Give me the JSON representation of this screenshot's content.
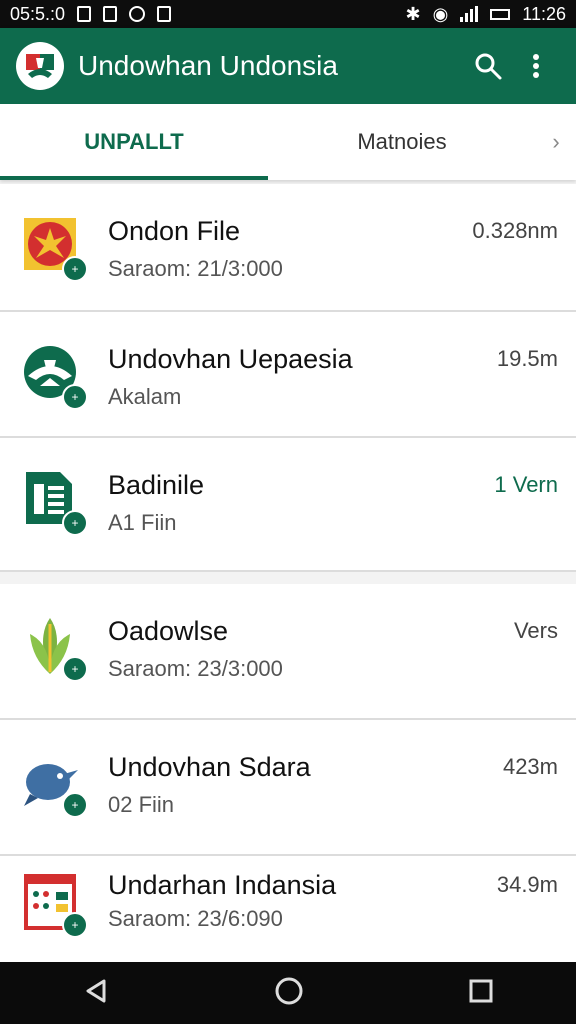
{
  "status": {
    "time_left": "05:5.:0",
    "time_right": "11:26"
  },
  "app_bar": {
    "title": "Undowhan Undonsia"
  },
  "tabs": [
    {
      "label": "UNPALLT",
      "active": true
    },
    {
      "label": "Matnoies",
      "active": false
    }
  ],
  "items": [
    {
      "name": "Ondon File",
      "sub": "Saraom: 21/3:000",
      "meta": "0.328nm",
      "icon": "emblem-icon"
    },
    {
      "name": "Undovhan Uepaesia",
      "sub": "Akalam",
      "meta": "19.5m",
      "icon": "garuda-icon"
    },
    {
      "name": "Badinile",
      "sub": "A1 Fiin",
      "meta": "1 Vern",
      "icon": "document-icon"
    },
    {
      "name": "Oadowlse",
      "sub": "Saraom: 23/3:000",
      "meta": "Vers",
      "icon": "plant-icon"
    },
    {
      "name": "Undovhan Sdara",
      "sub": "02 Fiin",
      "meta": "423m",
      "icon": "dolphin-icon"
    },
    {
      "name": "Undarhan Indansia",
      "sub": "Saraom: 23/6:090",
      "meta": "34.9m",
      "icon": "calendar-icon"
    }
  ],
  "colors": {
    "primary": "#0e6b4d",
    "accent_red": "#d32f2f"
  }
}
